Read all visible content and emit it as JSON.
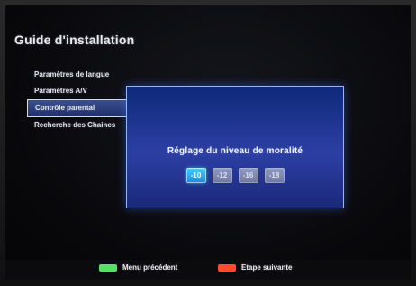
{
  "page": {
    "title": "Guide d'installation"
  },
  "menu": {
    "items": [
      {
        "label": "Paramètres de langue",
        "active": false
      },
      {
        "label": "Paramètres A/V",
        "active": false
      },
      {
        "label": "Contrôle parental",
        "active": true
      },
      {
        "label": "Recherche des Chaines",
        "active": false
      }
    ]
  },
  "dialog": {
    "heading": "Réglage du niveau de moralité",
    "levels": [
      "-10",
      "-12",
      "-16",
      "-18"
    ],
    "selected_index": 0
  },
  "footer": {
    "green": {
      "label": "Menu précédent",
      "color": "#55e06b"
    },
    "red": {
      "label": "Etape suivante",
      "color": "#ff4b2f"
    }
  },
  "colors": {
    "dialog_blue": "#2c3fa3",
    "selected_level": "#45d2ff"
  }
}
